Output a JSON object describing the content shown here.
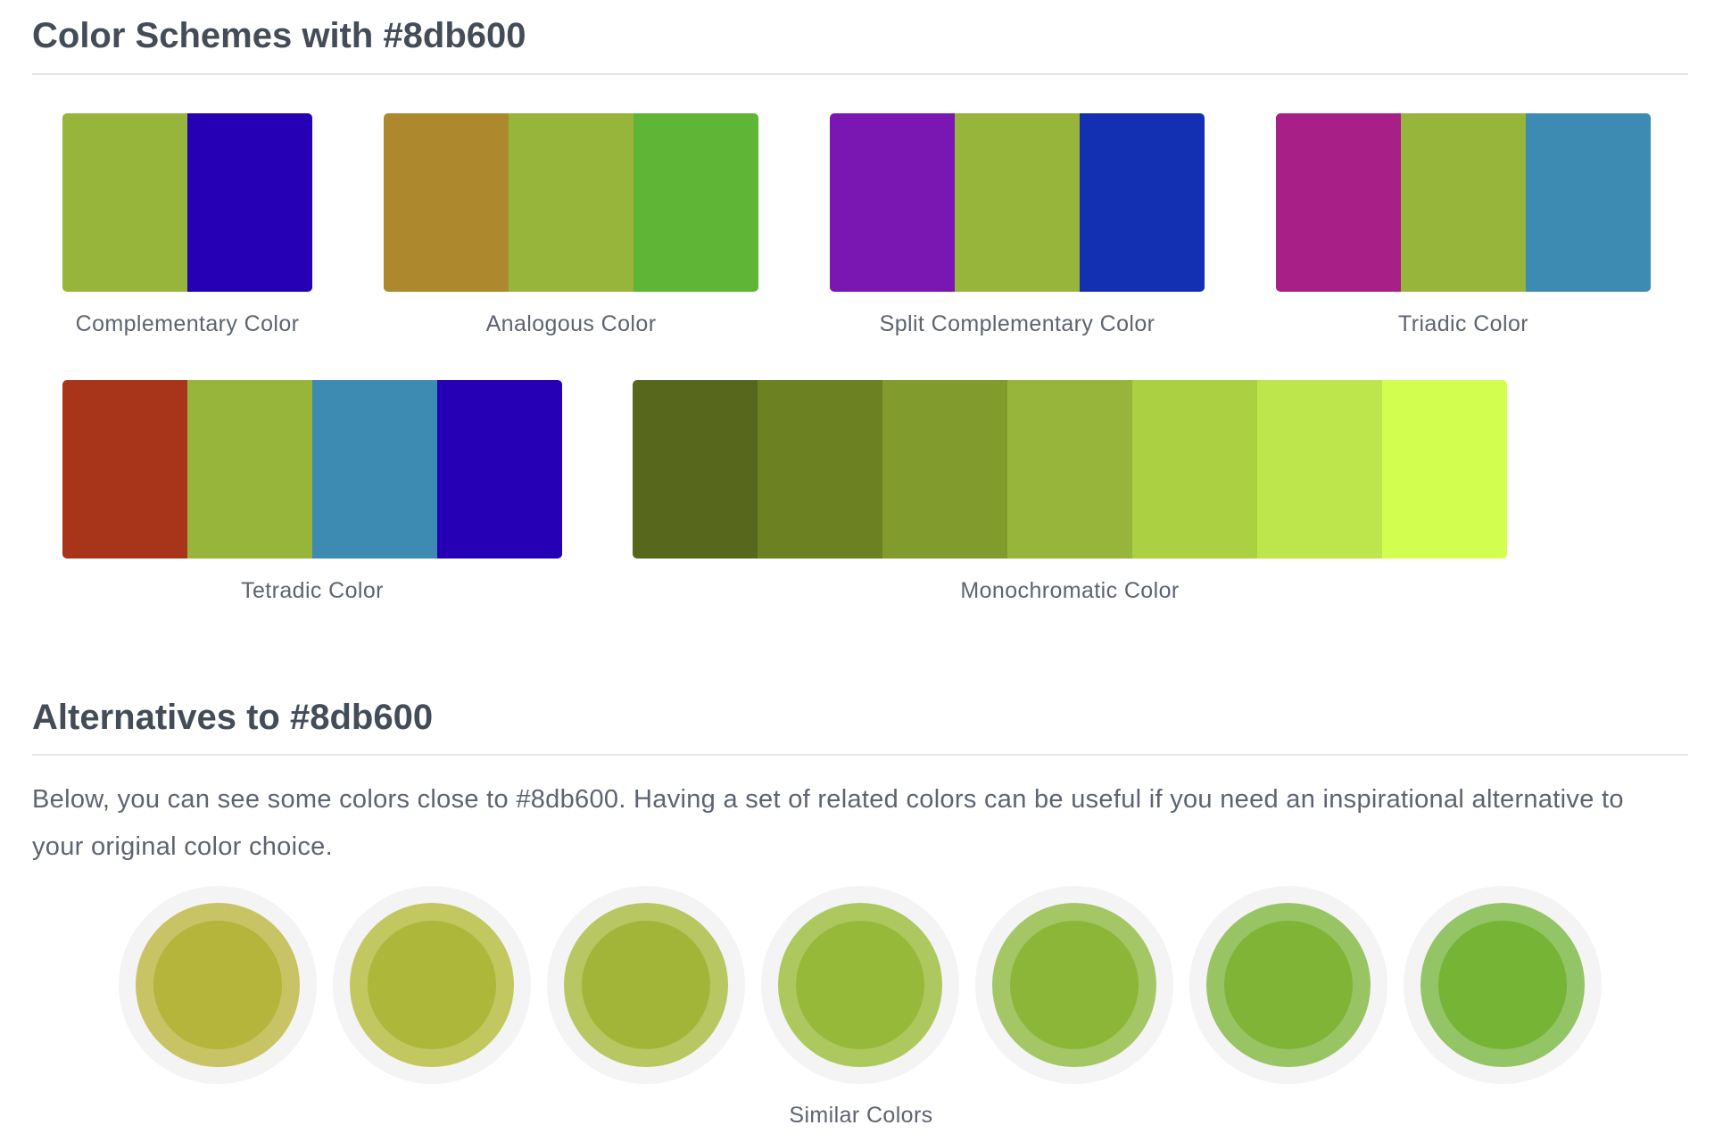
{
  "schemes_section": {
    "title": "Color Schemes with #8db600"
  },
  "schemes": {
    "complementary": {
      "label": "Complementary Color",
      "colors": [
        "#97b53a",
        "#2500b5"
      ]
    },
    "analogous": {
      "label": "Analogous Color",
      "colors": [
        "#ae882d",
        "#96b53a",
        "#5fb535"
      ]
    },
    "split_complementary": {
      "label": "Split Complementary Color",
      "colors": [
        "#7a16b1",
        "#96b53a",
        "#1230b1"
      ]
    },
    "triadic": {
      "label": "Triadic Color",
      "colors": [
        "#a91f88",
        "#96b53a",
        "#3d8bb3"
      ]
    },
    "tetradic": {
      "label": "Tetradic Color",
      "colors": [
        "#a83419",
        "#96b53a",
        "#3d8bb3",
        "#2500b5"
      ]
    },
    "monochromatic": {
      "label": "Monochromatic Color",
      "colors": [
        "#57681d",
        "#6b8122",
        "#819b2c",
        "#96b53a",
        "#abd142",
        "#bde64c",
        "#d2fe4f"
      ]
    }
  },
  "alternatives_section": {
    "title": "Alternatives to #8db600",
    "description": "Below, you can see some colors close to #8db600. Having a set of related colors can be useful if you need an inspirational alternative to your original color choice."
  },
  "similar_colors": {
    "label": "Similar Colors",
    "items": [
      {
        "ring": "#c8c365",
        "fill": "#b5b43b"
      },
      {
        "ring": "#c2c760",
        "fill": "#adb73a"
      },
      {
        "ring": "#b8c762",
        "fill": "#a3b539"
      },
      {
        "ring": "#adc85f",
        "fill": "#97b93a"
      },
      {
        "ring": "#a4c665",
        "fill": "#8cb638"
      },
      {
        "ring": "#99c463",
        "fill": "#80b437"
      },
      {
        "ring": "#93c465",
        "fill": "#76b436"
      }
    ]
  }
}
